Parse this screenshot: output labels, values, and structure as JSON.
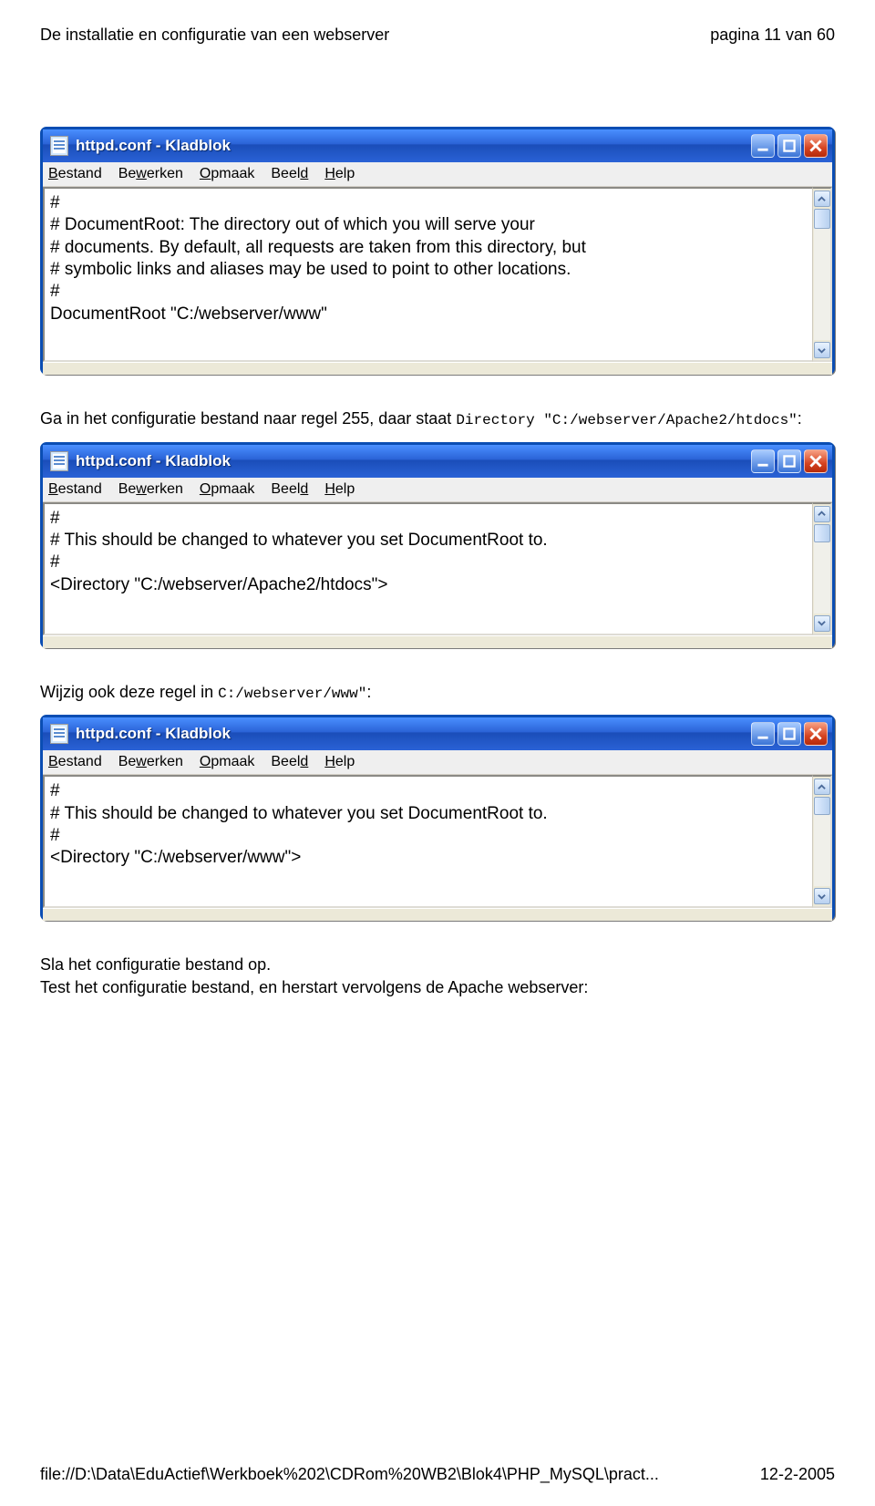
{
  "header": {
    "left": "De installatie en configuratie van een webserver",
    "right": "pagina 11 van 60"
  },
  "para1_pre": "Ga in het configuratie bestand naar regel 255, daar staat ",
  "para1_code": "Directory \"C:/webserver/Apache2/htdocs\"",
  "para1_post": ":",
  "para2_pre": "Wijzig ook deze regel in ",
  "para2_code": "C:/webserver/www\"",
  "para2_post": ":",
  "para3_line1": "Sla het configuratie bestand op.",
  "para3_line2": "Test het configuratie bestand, en herstart vervolgens de Apache webserver:",
  "notepad": {
    "title": "httpd.conf - Kladblok",
    "menus": [
      {
        "pre": "",
        "ul": "B",
        "post": "estand"
      },
      {
        "pre": "Be",
        "ul": "w",
        "post": "erken"
      },
      {
        "pre": "",
        "ul": "O",
        "post": "pmaak"
      },
      {
        "pre": "Beel",
        "ul": "d",
        "post": ""
      },
      {
        "pre": "",
        "ul": "H",
        "post": "elp"
      }
    ]
  },
  "np1_text": "#\n# DocumentRoot: The directory out of which you will serve your\n# documents. By default, all requests are taken from this directory, but\n# symbolic links and aliases may be used to point to other locations.\n#\nDocumentRoot \"C:/webserver/www\"",
  "np2_text": "#\n# This should be changed to whatever you set DocumentRoot to.\n#\n<Directory \"C:/webserver/Apache2/htdocs\">",
  "np3_text": "#\n# This should be changed to whatever you set DocumentRoot to.\n#\n<Directory \"C:/webserver/www\">",
  "footer": {
    "left": "file://D:\\Data\\EduActief\\Werkboek%202\\CDRom%20WB2\\Blok4\\PHP_MySQL\\pract...",
    "right": "12-2-2005"
  }
}
